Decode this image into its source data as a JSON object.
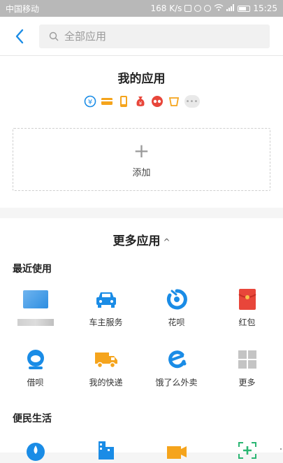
{
  "status_bar": {
    "carrier": "中国移动",
    "speed": "168 K/s",
    "time": "15:25"
  },
  "search": {
    "placeholder": "全部应用"
  },
  "my_apps": {
    "title": "我的应用",
    "mini_icons": [
      "yuebao-icon",
      "card-icon",
      "phone-icon",
      "money-bag-icon",
      "glasses-icon",
      "cup-icon"
    ],
    "more_dots": "•••",
    "add_plus": "+",
    "add_label": "添加"
  },
  "more_apps": {
    "title": "更多应用",
    "caret": "^"
  },
  "recent": {
    "heading": "最近使用",
    "row1": [
      {
        "label": "",
        "icon": "blurred-app-icon"
      },
      {
        "label": "车主服务",
        "icon": "car-icon"
      },
      {
        "label": "花呗",
        "icon": "huabei-icon"
      },
      {
        "label": "红包",
        "icon": "red-envelope-icon"
      }
    ],
    "row2": [
      {
        "label": "借呗",
        "icon": "jiebei-icon"
      },
      {
        "label": "我的快递",
        "icon": "delivery-truck-icon"
      },
      {
        "label": "饿了么外卖",
        "icon": "eleme-icon"
      },
      {
        "label": "更多",
        "icon": "grid-more-icon"
      }
    ]
  },
  "life": {
    "heading": "便民生活"
  },
  "colors": {
    "accent": "#1a8ce6",
    "orange": "#f5a41c",
    "red": "#e8463a"
  }
}
